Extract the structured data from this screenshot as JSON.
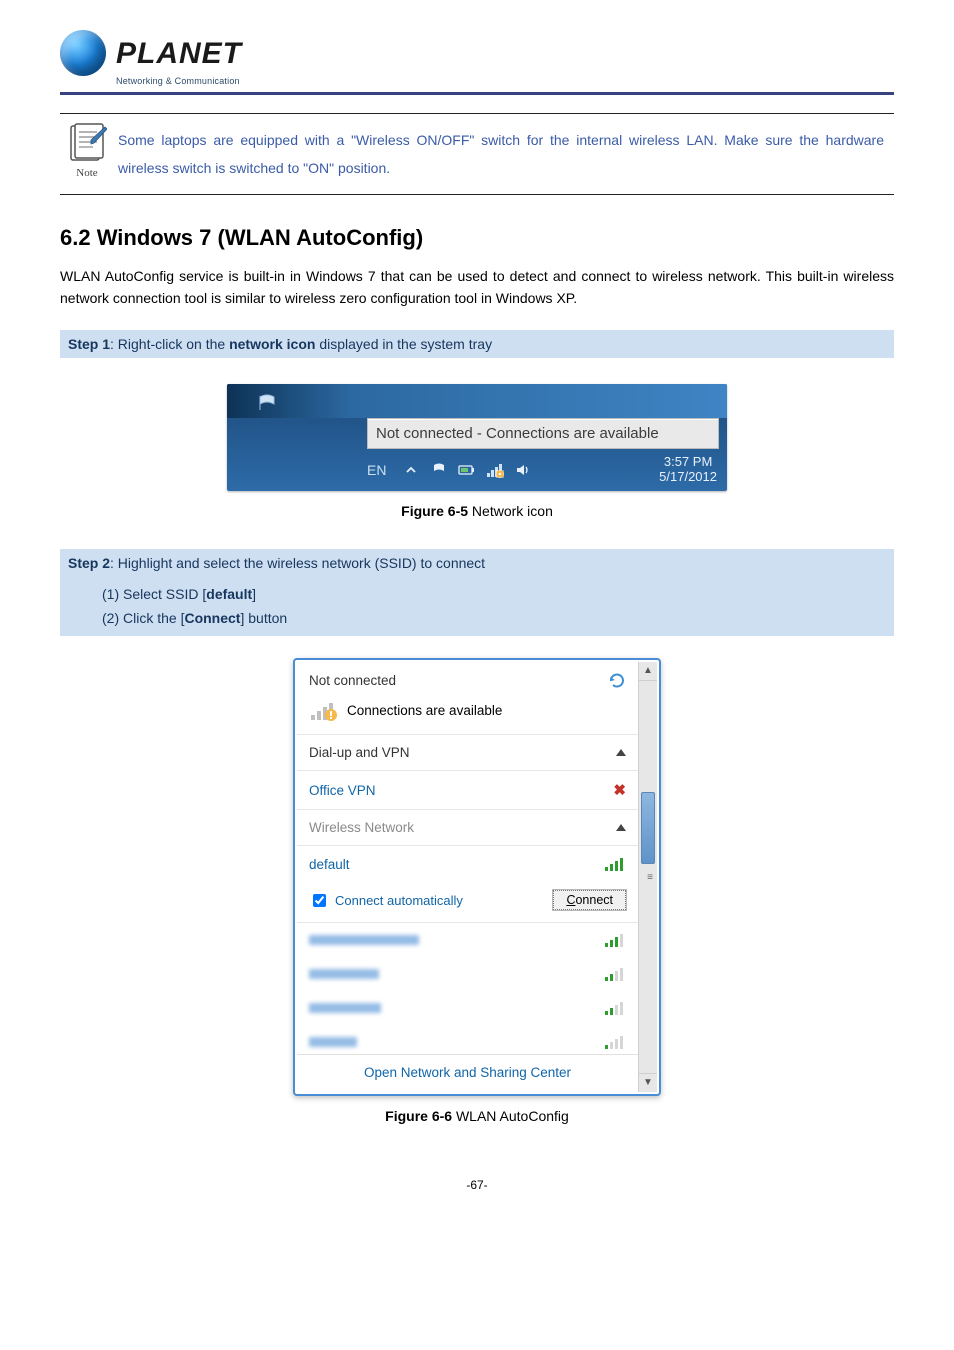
{
  "header": {
    "logo_text": "PLANET",
    "logo_tagline": "Networking & Communication"
  },
  "note": {
    "label": "Note",
    "text": "Some laptops are equipped with a \"Wireless ON/OFF\" switch for the internal wireless LAN. Make sure the hardware wireless switch is switched to \"ON\" position."
  },
  "section_title": "6.2  Windows 7 (WLAN AutoConfig)",
  "intro_paragraph": "WLAN AutoConfig service is built-in in Windows 7 that can be used to detect and connect to wireless network. This built-in wireless network connection tool is similar to wireless zero configuration tool in Windows XP.",
  "step1": {
    "label": "Step 1",
    "text_before": ": Right-click on the ",
    "bold1": "network icon",
    "text_after": " displayed in the system tray"
  },
  "tray": {
    "tooltip": "Not connected - Connections are available",
    "lang": "EN",
    "time": "3:57 PM",
    "date": "5/17/2012"
  },
  "figure1_caption_bold": "Figure 6-5",
  "figure1_caption_rest": " Network icon",
  "step2": {
    "label": "Step 2",
    "text": ": Highlight and select the wireless network (SSID) to connect",
    "item1_prefix": "(1)  Select SSID [",
    "item1_bold": "default",
    "item1_suffix": "]",
    "item2_prefix": "(2)  Click the [",
    "item2_bold": "Connect",
    "item2_suffix": "] button"
  },
  "wlan": {
    "not_connected": "Not connected",
    "conns_avail": "Connections are available",
    "dialup": "Dial-up and VPN",
    "office_vpn": "Office VPN",
    "wnw": "Wireless Network",
    "default": "default",
    "auto": "Connect automatically",
    "connect_btn": "Connect",
    "connect_key": "C",
    "footer": "Open Network and Sharing Center"
  },
  "figure2_caption_bold": "Figure 6-6",
  "figure2_caption_rest": " WLAN AutoConfig",
  "page_number": "-67-"
}
